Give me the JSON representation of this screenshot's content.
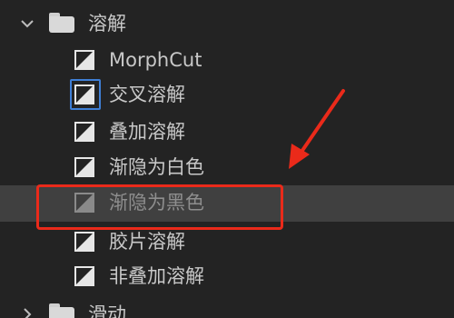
{
  "folders": {
    "dissolve": {
      "label": "溶解",
      "icon": "folder-icon"
    },
    "slide": {
      "label": "滑动",
      "icon": "folder-icon"
    }
  },
  "items": [
    {
      "label": "MorphCut",
      "icon": "transition-icon"
    },
    {
      "label": "交叉溶解",
      "icon": "transition-icon"
    },
    {
      "label": "叠加溶解",
      "icon": "transition-icon"
    },
    {
      "label": "渐隐为白色",
      "icon": "transition-icon"
    },
    {
      "label": "渐隐为黑色",
      "icon": "transition-icon"
    },
    {
      "label": "胶片溶解",
      "icon": "transition-icon"
    },
    {
      "label": "非叠加溶解",
      "icon": "transition-icon"
    }
  ],
  "annotation": {
    "color": "#ea2a1a"
  },
  "colors": {
    "background": "#232323",
    "highlight": "#404040",
    "selection": "#3f7fd6",
    "text": "#c8c8c8"
  }
}
